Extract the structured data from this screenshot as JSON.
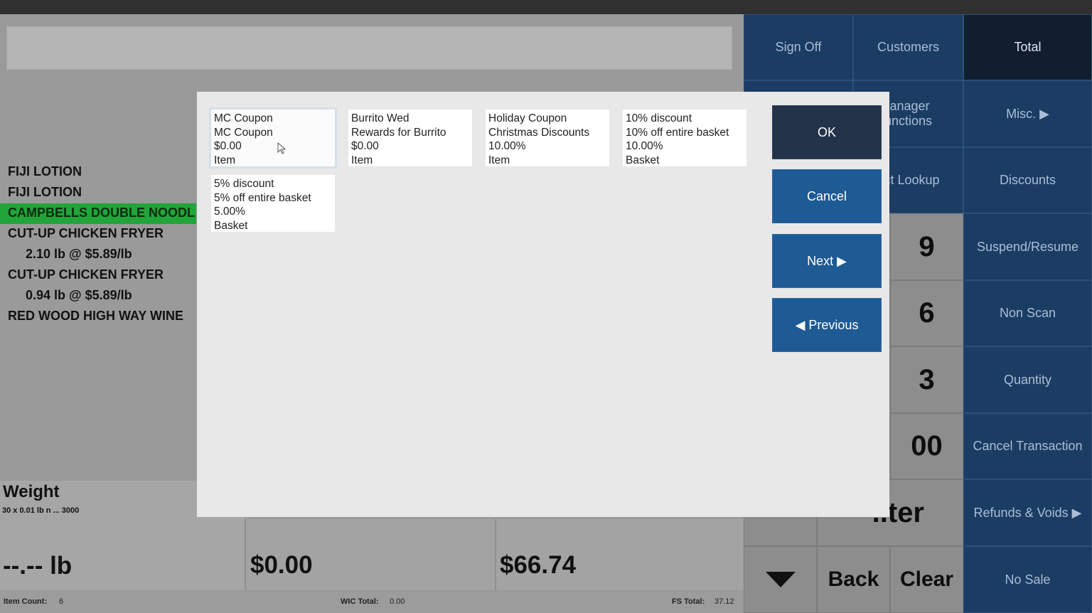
{
  "receipt": {
    "lines": [
      {
        "text": "FIJI LOTION"
      },
      {
        "text": "FIJI LOTION"
      },
      {
        "text": "CAMPBELLS DOUBLE NOODL"
      },
      {
        "text": "CUT-UP CHICKEN FRYER"
      },
      {
        "text": "2.10 lb @ $5.89/lb"
      },
      {
        "text": "CUT-UP CHICKEN FRYER"
      },
      {
        "text": "0.94 lb @ $5.89/lb"
      },
      {
        "text": "RED WOOD HIGH WAY WINE"
      }
    ]
  },
  "weight": {
    "label": "Weight",
    "sub": "30 x 0.01 lb n ... 3000",
    "value": "--.-- lb"
  },
  "totals": {
    "middle": "$0.00",
    "total": "$66.74"
  },
  "footer": {
    "item_count_label": "Item Count:",
    "item_count": "6",
    "wic_label": "WIC Total:",
    "wic": "0.00",
    "fs_label": "FS Total:",
    "fs": "37.12"
  },
  "right_panel": {
    "sign_off": "Sign Off",
    "customers": "Customers",
    "total": "Total",
    "manager": "lanager",
    "manager2": "unctions",
    "misc": "Misc. ▶",
    "lookup": "uct Lookup",
    "discounts": "Discounts",
    "k9": "9",
    "suspend": "Suspend/Resume",
    "k6": "6",
    "non_scan": "Non Scan",
    "k3": "3",
    "quantity": "Quantity",
    "k00": "00",
    "cancel_txn": "Cancel Transaction",
    "enter": "..ter",
    "refunds": "Refunds & Voids ▶",
    "back": "Back",
    "clear": "Clear",
    "no_sale": "No Sale"
  },
  "modal": {
    "cards": [
      {
        "l1": "MC Coupon",
        "l2": "MC Coupon",
        "l3": "$0.00",
        "l4": "Item"
      },
      {
        "l1": "Burrito Wed",
        "l2": "Rewards for Burrito",
        "l3": "$0.00",
        "l4": "Item"
      },
      {
        "l1": "Holiday Coupon",
        "l2": "Christmas Discounts",
        "l3": "10.00%",
        "l4": "Item"
      },
      {
        "l1": "10% discount",
        "l2": "10% off entire basket",
        "l3": "10.00%",
        "l4": "Basket"
      },
      {
        "l1": "5% discount",
        "l2": "5% off entire basket",
        "l3": "5.00%",
        "l4": "Basket"
      }
    ],
    "ok": "OK",
    "cancel": "Cancel",
    "next": "Next ▶",
    "previous": "◀ Previous"
  },
  "colors": {
    "selected_line": "#21a53a",
    "button_blue": "#1e5a94",
    "button_dark": "#22334a",
    "panel_blue": "#1b3c63"
  }
}
